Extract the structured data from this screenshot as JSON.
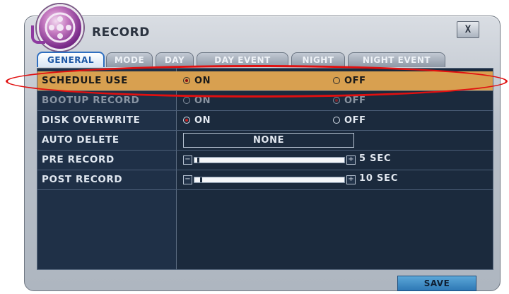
{
  "window": {
    "title": "RECORD",
    "close_label": "X"
  },
  "tabs": [
    {
      "label": "GENERAL",
      "active": true
    },
    {
      "label": "MODE",
      "active": false
    },
    {
      "label": "DAY",
      "active": false
    },
    {
      "label": "DAY EVENT",
      "active": false
    },
    {
      "label": "NIGHT",
      "active": false
    },
    {
      "label": "NIGHT EVENT",
      "active": false
    }
  ],
  "settings": {
    "schedule_use": {
      "label": "SCHEDULE USE",
      "on_label": "ON",
      "off_label": "OFF",
      "selected": "ON"
    },
    "bootup_record": {
      "label": "BOOTUP RECORD",
      "on_label": "ON",
      "off_label": "OFF",
      "selected": "OFF"
    },
    "disk_overwrite": {
      "label": "DISK OVERWRITE",
      "on_label": "ON",
      "off_label": "OFF",
      "selected": "ON"
    },
    "auto_delete": {
      "label": "AUTO DELETE",
      "value": "NONE"
    },
    "pre_record": {
      "label": "PRE RECORD",
      "value": "5 SEC",
      "level": 0.02,
      "minus": "−",
      "plus": "+"
    },
    "post_record": {
      "label": "POST RECORD",
      "value": "10 SEC",
      "level": 0.04,
      "minus": "−",
      "plus": "+"
    }
  },
  "footer": {
    "save_label": "SAVE"
  },
  "colors": {
    "highlight_row": "#d8a050",
    "annotation_ellipse": "#e11010",
    "panel_bg": "#1b2a3d"
  },
  "icons": {
    "logo": "film-reel-icon",
    "close": "close-icon",
    "slider_minus": "minus-icon",
    "slider_plus": "plus-icon"
  }
}
